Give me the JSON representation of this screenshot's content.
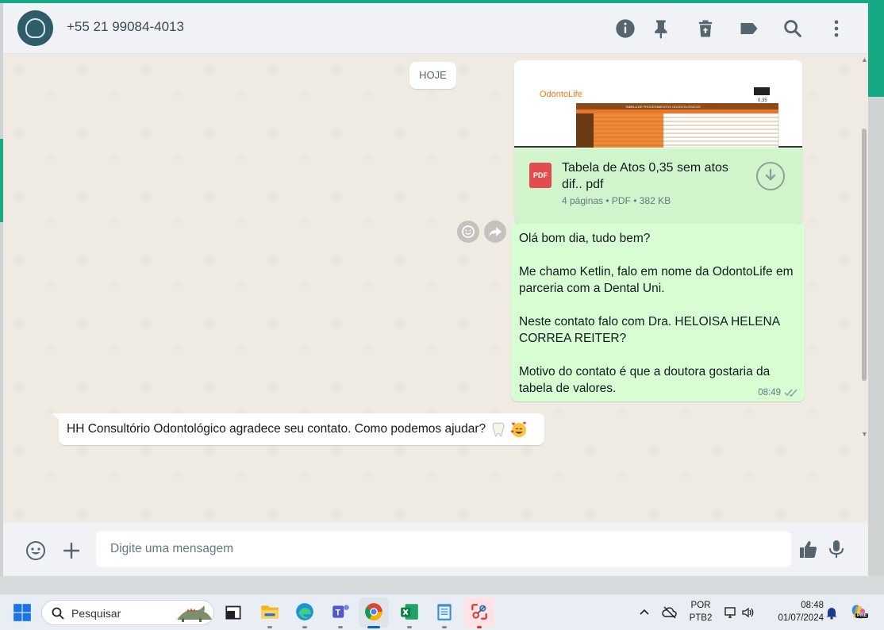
{
  "contact": {
    "name": "+55 21 99084-4013"
  },
  "header_icons": [
    "info-icon",
    "pin-icon",
    "trash-icon",
    "label-icon",
    "search-icon",
    "menu-icon"
  ],
  "chat": {
    "date_divider": "HOJE",
    "document": {
      "file_name": "Tabela de Atos 0,35 sem atos dif.. pdf",
      "type_badge": "PDF",
      "meta": "4 páginas • PDF • 382 KB",
      "preview_title": "TABELA DE PROCEDIMENTOS ODONTOLÓGICOS",
      "preview_brand": "OdontoLife",
      "preview_value": "0,35"
    },
    "outgoing_message": {
      "lines": [
        "Olá bom dia, tudo bem?",
        "",
        "Me chamo Ketlin, falo em nome da OdontoLife em",
        "parceria com a Dental Uni.",
        "",
        "Neste contato falo com Dra. HELOISA HELENA",
        "CORREA REITER?",
        "",
        "Motivo do contato é que a doutora gostaria da",
        "tabela de valores."
      ],
      "time": "08:49",
      "status": "read"
    },
    "incoming_message": {
      "text": "HH Consultório Odontológico agradece seu contato. Como podemos ajudar?",
      "emojis": [
        "tooth",
        "smiling-face-with-hearts"
      ]
    }
  },
  "composer": {
    "placeholder": "Digite uma mensagem"
  },
  "taskbar": {
    "search_label": "Pesquisar",
    "language": "POR",
    "layout": "PTB2",
    "time": "08:48",
    "date": "01/07/2024",
    "copilot_badge": "PRE"
  },
  "colors": {
    "outgoing_bubble": "#d9fdd3",
    "chat_background": "#efeae2",
    "accent": "#17a884"
  }
}
